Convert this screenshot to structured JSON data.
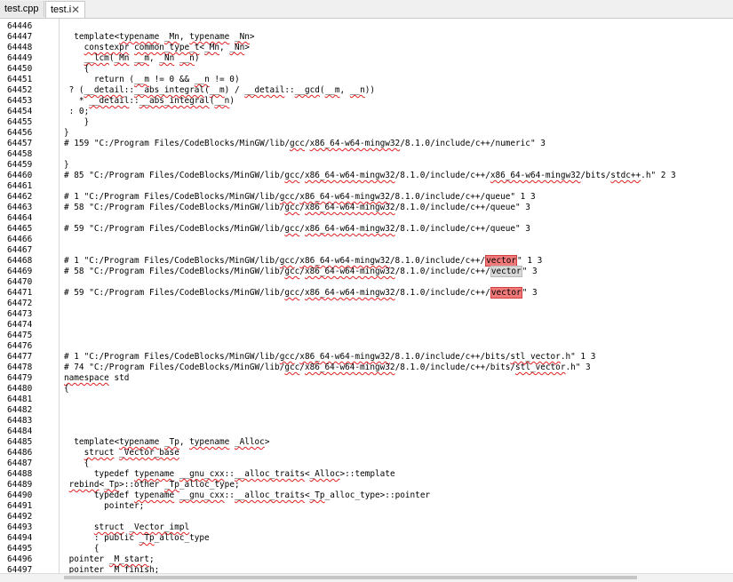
{
  "tabs": [
    {
      "label": "test.cpp",
      "active": false
    },
    {
      "label": "test.i",
      "active": true,
      "close": "✕"
    }
  ],
  "lines": [
    {
      "n": "64446",
      "t": ""
    },
    {
      "n": "64447",
      "t": "  template<typename _Mn, typename _Nn>"
    },
    {
      "n": "64448",
      "t": "    constexpr common_type_t<_Mn, _Nn>"
    },
    {
      "n": "64449",
      "t": "    __lcm(_Mn __m, _Nn __n)"
    },
    {
      "n": "64450",
      "t": "    {"
    },
    {
      "n": "64451",
      "t": "      return (__m != 0 && __n != 0)"
    },
    {
      "n": "64452",
      "t": " ? (__detail::__abs_integral(__m) / __detail::__gcd(__m, __n))"
    },
    {
      "n": "64453",
      "t": "   * __detail::__abs_integral(__n)"
    },
    {
      "n": "64454",
      "t": " : 0;"
    },
    {
      "n": "64455",
      "t": "    }"
    },
    {
      "n": "64456",
      "t": "}"
    },
    {
      "n": "64457",
      "t": "# 159 \"C:/Program Files/CodeBlocks/MinGW/lib/gcc/x86_64-w64-mingw32/8.1.0/include/c++/numeric\" 3"
    },
    {
      "n": "64458",
      "t": ""
    },
    {
      "n": "64459",
      "t": "}"
    },
    {
      "n": "64460",
      "t": "# 85 \"C:/Program Files/CodeBlocks/MinGW/lib/gcc/x86_64-w64-mingw32/8.1.0/include/c++/x86_64-w64-mingw32/bits/stdc++.h\" 2 3"
    },
    {
      "n": "64461",
      "t": ""
    },
    {
      "n": "64462",
      "t": "# 1 \"C:/Program Files/CodeBlocks/MinGW/lib/gcc/x86_64-w64-mingw32/8.1.0/include/c++/queue\" 1 3"
    },
    {
      "n": "64463",
      "t": "# 58 \"C:/Program Files/CodeBlocks/MinGW/lib/gcc/x86_64-w64-mingw32/8.1.0/include/c++/queue\" 3"
    },
    {
      "n": "64464",
      "t": ""
    },
    {
      "n": "64465",
      "t": "# 59 \"C:/Program Files/CodeBlocks/MinGW/lib/gcc/x86_64-w64-mingw32/8.1.0/include/c++/queue\" 3"
    },
    {
      "n": "64466",
      "t": ""
    },
    {
      "n": "64467",
      "t": ""
    },
    {
      "n": "64468",
      "t": "# 1 \"C:/Program Files/CodeBlocks/MinGW/lib/gcc/x86_64-w64-mingw32/8.1.0/include/c++/vector\" 1 3"
    },
    {
      "n": "64469",
      "t": "# 58 \"C:/Program Files/CodeBlocks/MinGW/lib/gcc/x86_64-w64-mingw32/8.1.0/include/c++/vector\" 3"
    },
    {
      "n": "64470",
      "t": ""
    },
    {
      "n": "64471",
      "t": "# 59 \"C:/Program Files/CodeBlocks/MinGW/lib/gcc/x86_64-w64-mingw32/8.1.0/include/c++/vector\" 3"
    },
    {
      "n": "64472",
      "t": ""
    },
    {
      "n": "64473",
      "t": ""
    },
    {
      "n": "64474",
      "t": ""
    },
    {
      "n": "64475",
      "t": ""
    },
    {
      "n": "64476",
      "t": ""
    },
    {
      "n": "64477",
      "t": "# 1 \"C:/Program Files/CodeBlocks/MinGW/lib/gcc/x86_64-w64-mingw32/8.1.0/include/c++/bits/stl_vector.h\" 1 3"
    },
    {
      "n": "64478",
      "t": "# 74 \"C:/Program Files/CodeBlocks/MinGW/lib/gcc/x86_64-w64-mingw32/8.1.0/include/c++/bits/stl_vector.h\" 3"
    },
    {
      "n": "64479",
      "t": "namespace std"
    },
    {
      "n": "64480",
      "t": "{"
    },
    {
      "n": "64481",
      "t": ""
    },
    {
      "n": "64482",
      "t": ""
    },
    {
      "n": "64483",
      "t": ""
    },
    {
      "n": "64484",
      "t": ""
    },
    {
      "n": "64485",
      "t": "  template<typename _Tp, typename _Alloc>"
    },
    {
      "n": "64486",
      "t": "    struct _Vector_base"
    },
    {
      "n": "64487",
      "t": "    {"
    },
    {
      "n": "64488",
      "t": "      typedef typename __gnu_cxx::__alloc_traits<_Alloc>::template"
    },
    {
      "n": "64489",
      "t": " rebind<_Tp>::other _Tp_alloc_type;"
    },
    {
      "n": "64490",
      "t": "      typedef typename __gnu_cxx::__alloc_traits<_Tp_alloc_type>::pointer"
    },
    {
      "n": "64491",
      "t": "        pointer;"
    },
    {
      "n": "64492",
      "t": ""
    },
    {
      "n": "64493",
      "t": "      struct _Vector_impl"
    },
    {
      "n": "64494",
      "t": "      : public _Tp_alloc_type"
    },
    {
      "n": "64495",
      "t": "      {"
    },
    {
      "n": "64496",
      "t": " pointer _M_start;"
    },
    {
      "n": "64497",
      "t": " pointer _M_finish;"
    }
  ],
  "colors": {
    "squiggle": "#e02020",
    "highlight_red": "#f07a7a",
    "highlight_grey": "#d8d8d8"
  }
}
